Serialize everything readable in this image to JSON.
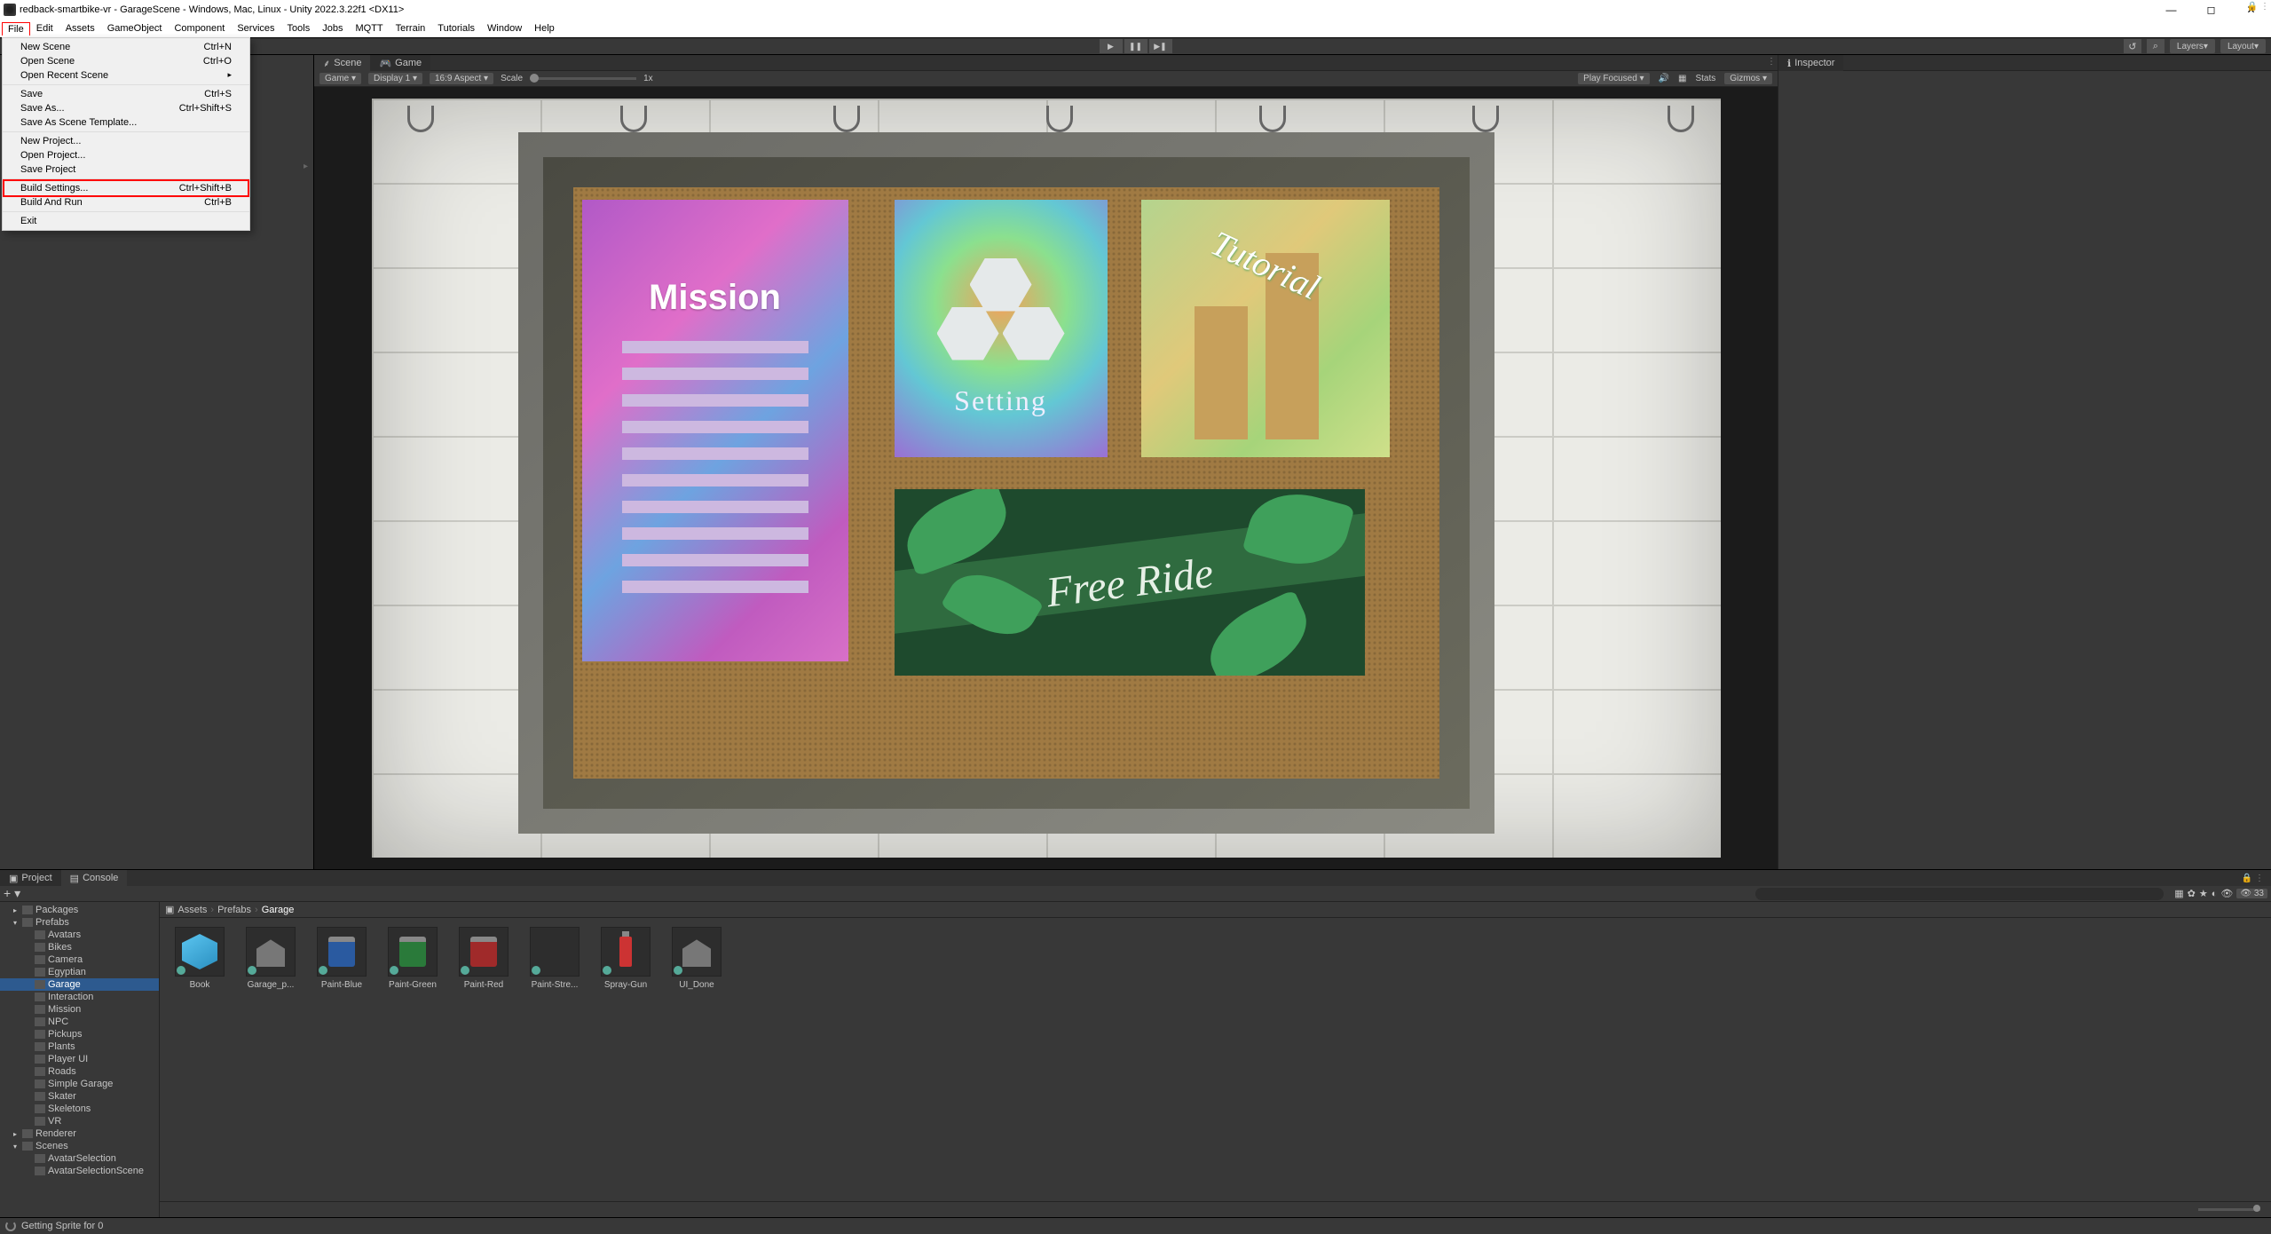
{
  "window": {
    "title": "redback-smartbike-vr - GarageScene - Windows, Mac, Linux - Unity 2022.3.22f1 <DX11>"
  },
  "menubar": [
    "File",
    "Edit",
    "Assets",
    "GameObject",
    "Component",
    "Services",
    "Tools",
    "Jobs",
    "MQTT",
    "Terrain",
    "Tutorials",
    "Window",
    "Help"
  ],
  "file_menu": [
    {
      "label": "New Scene",
      "shortcut": "Ctrl+N"
    },
    {
      "label": "Open Scene",
      "shortcut": "Ctrl+O"
    },
    {
      "label": "Open Recent Scene",
      "shortcut": "",
      "submenu": true
    },
    {
      "sep": true
    },
    {
      "label": "Save",
      "shortcut": "Ctrl+S"
    },
    {
      "label": "Save As...",
      "shortcut": "Ctrl+Shift+S"
    },
    {
      "label": "Save As Scene Template..."
    },
    {
      "sep": true
    },
    {
      "label": "New Project..."
    },
    {
      "label": "Open Project..."
    },
    {
      "label": "Save Project"
    },
    {
      "sep": true
    },
    {
      "label": "Build Settings...",
      "shortcut": "Ctrl+Shift+B",
      "highlight": true
    },
    {
      "label": "Build And Run",
      "shortcut": "Ctrl+B"
    },
    {
      "sep": true
    },
    {
      "label": "Exit"
    }
  ],
  "toolbar_right": {
    "layers": "Layers",
    "layout": "Layout"
  },
  "scene_tabs": {
    "scene": "Scene",
    "game": "Game"
  },
  "game_toolbar": {
    "mode": "Game",
    "display": "Display 1",
    "aspect": "16:9 Aspect",
    "scale_label": "Scale",
    "scale_value": "1x",
    "play_focused": "Play Focused",
    "stats": "Stats",
    "gizmos": "Gizmos"
  },
  "board": {
    "mission": "Mission",
    "setting": "Setting",
    "tutorial": "Tutorial",
    "freeride": "Free Ride"
  },
  "inspector": {
    "tab": "Inspector"
  },
  "bottom_tabs": {
    "project": "Project",
    "console": "Console"
  },
  "bottom_toolbar": {
    "count": "33"
  },
  "breadcrumb": [
    "Assets",
    "Prefabs",
    "Garage"
  ],
  "tree": [
    {
      "d": 1,
      "label": "Packages",
      "open": true,
      "tw": "▸"
    },
    {
      "d": 1,
      "label": "Prefabs",
      "open": true,
      "tw": "▾"
    },
    {
      "d": 2,
      "label": "Avatars"
    },
    {
      "d": 2,
      "label": "Bikes"
    },
    {
      "d": 2,
      "label": "Camera"
    },
    {
      "d": 2,
      "label": "Egyptian"
    },
    {
      "d": 2,
      "label": "Garage",
      "sel": true
    },
    {
      "d": 2,
      "label": "Interaction"
    },
    {
      "d": 2,
      "label": "Mission"
    },
    {
      "d": 2,
      "label": "NPC"
    },
    {
      "d": 2,
      "label": "Pickups"
    },
    {
      "d": 2,
      "label": "Plants"
    },
    {
      "d": 2,
      "label": "Player UI"
    },
    {
      "d": 2,
      "label": "Roads"
    },
    {
      "d": 2,
      "label": "Simple Garage"
    },
    {
      "d": 2,
      "label": "Skater"
    },
    {
      "d": 2,
      "label": "Skeletons"
    },
    {
      "d": 2,
      "label": "VR"
    },
    {
      "d": 1,
      "label": "Renderer",
      "tw": "▸"
    },
    {
      "d": 1,
      "label": "Scenes",
      "open": true,
      "tw": "▾"
    },
    {
      "d": 2,
      "label": "AvatarSelection"
    },
    {
      "d": 2,
      "label": "AvatarSelectionScene"
    }
  ],
  "assets": [
    {
      "label": "Book",
      "type": "cube"
    },
    {
      "label": "Garage_p...",
      "type": "garage"
    },
    {
      "label": "Paint-Blue",
      "type": "paint",
      "color": "#2a5aa0"
    },
    {
      "label": "Paint-Green",
      "type": "paint",
      "color": "#2a7a3a"
    },
    {
      "label": "Paint-Red",
      "type": "paint",
      "color": "#a02a2a"
    },
    {
      "label": "Paint-Stre...",
      "type": "blank"
    },
    {
      "label": "Spray-Gun",
      "type": "spray"
    },
    {
      "label": "UI_Done",
      "type": "garage"
    }
  ],
  "status": {
    "text": "Getting Sprite for 0"
  }
}
